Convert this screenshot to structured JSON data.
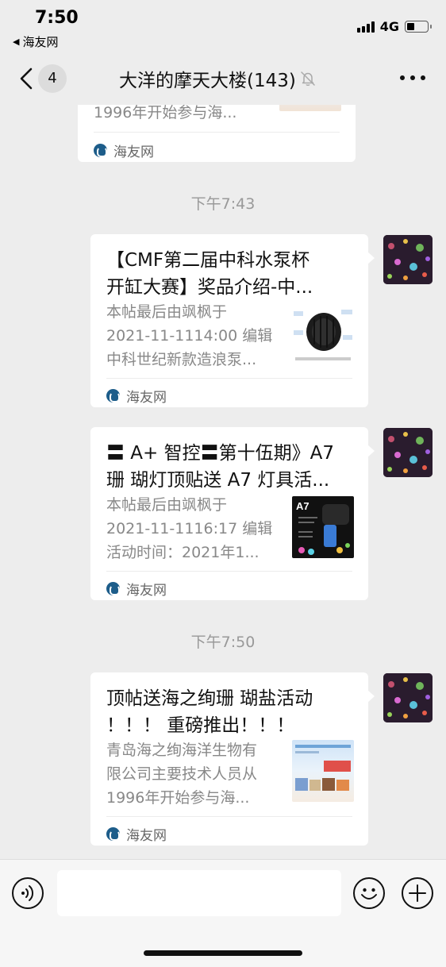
{
  "status_bar": {
    "time": "7:50",
    "back_app": "海友网",
    "network": "4G",
    "battery_level": 0.38
  },
  "nav": {
    "back_count": "4",
    "title": "大洋的摩天大楼(143)"
  },
  "messages": {
    "card0": {
      "desc3": "1996年开始参与海...",
      "source": "海友网"
    },
    "time1": "下午7:43",
    "card1": {
      "title1": "【CMF第二届中科水泵杯",
      "title2": "开缸大赛】奖品介绍-中...",
      "desc1": "本帖最后由飒枫于",
      "desc2": "2021-11-1114:00 编辑",
      "desc3": "中科世纪新款造浪泵...",
      "source": "海友网"
    },
    "card2": {
      "title1": "〓 A+ 智控〓第十伍期》A7",
      "title2": "珊 瑚灯顶贴送 A7 灯具活...",
      "desc1": "本帖最后由飒枫于",
      "desc2": "2021-11-1116:17 编辑",
      "desc3": "活动时间：2021年1...",
      "thumb_label": "A7",
      "source": "海友网"
    },
    "time2": "下午7:50",
    "card3": {
      "title1": "顶帖送海之绚珊 瑚盐活动",
      "title2": "！！！ 重磅推出！！！",
      "desc1": "青岛海之绚海洋生物有",
      "desc2": "限公司主要技术人员从",
      "desc3": "1996年开始参与海...",
      "source": "海友网"
    }
  },
  "colors": {
    "background": "#ededed",
    "card": "#ffffff",
    "source_icon": "#1d5d8a",
    "muted_text": "#888888"
  }
}
